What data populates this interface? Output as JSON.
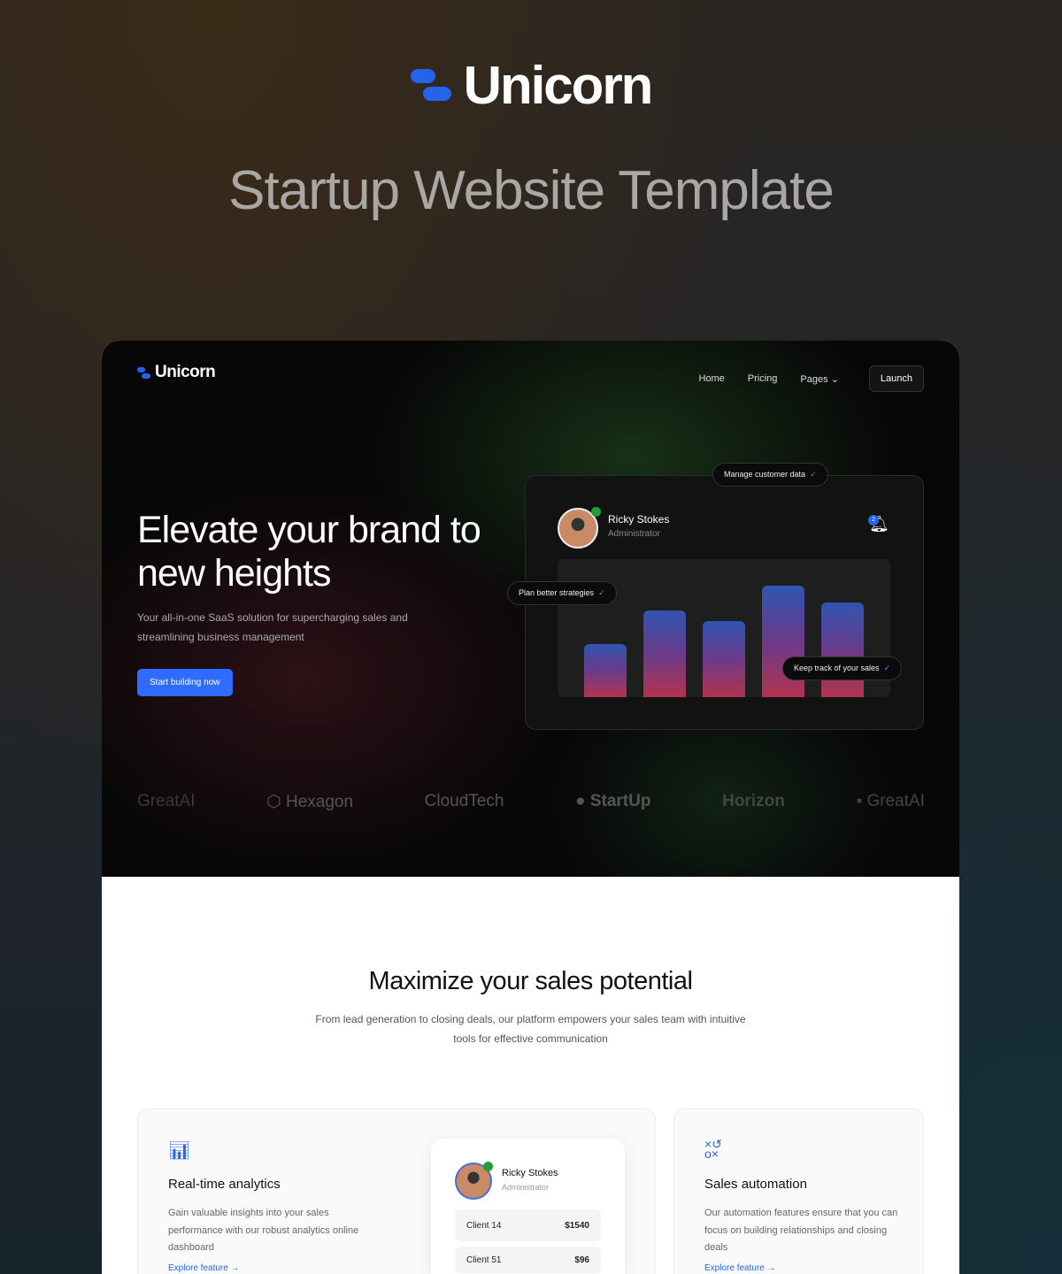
{
  "brand": {
    "name": "Unicorn",
    "subtitle": "Startup Website Template",
    "color": "#2563eb"
  },
  "nav": {
    "logo": "Unicorn",
    "items": [
      "Home",
      "Pricing",
      "Pages"
    ],
    "launch": "Launch"
  },
  "hero": {
    "title": "Elevate your brand to new heights",
    "lead": "Your all-in-one SaaS solution for supercharging sales and streamlining business management",
    "cta": "Start building now"
  },
  "dashboard": {
    "user": "Ricky Stokes",
    "role": "Administrator",
    "notifications": "2",
    "bars_relative": [
      48,
      78,
      68,
      100,
      85
    ],
    "pills": [
      "Manage customer data",
      "Plan better strategies",
      "Keep track of your sales"
    ]
  },
  "logos": [
    "GreatAI",
    "Hexagon",
    "CloudTech",
    "StartUp",
    "Horizon",
    "GreatAI"
  ],
  "section": {
    "title": "Maximize your sales potential",
    "subtitle": "From lead generation to closing deals, our platform empowers your sales team with intuitive tools for effective communication"
  },
  "features": [
    {
      "icon": "presentation-chart-icon",
      "title": "Real-time analytics",
      "text": "Gain valuable insights into your sales performance with our robust analytics online dashboard",
      "link": "Explore feature →"
    },
    {
      "icon": "strategy-icon",
      "title": "Sales automation",
      "text": "Our automation features ensure that you can focus on building relationships and closing deals",
      "link": "Explore feature →"
    }
  ],
  "mini_card": {
    "user": "Ricky Stokes",
    "role": "Administrator",
    "clients": [
      {
        "name": "Client 14",
        "amount": "$1540"
      },
      {
        "name": "Client 51",
        "amount": "$96"
      }
    ]
  }
}
